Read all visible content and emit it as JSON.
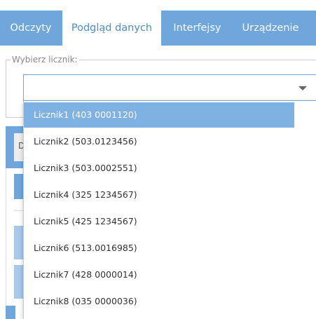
{
  "tabs": [
    {
      "label": "Odczyty",
      "active": false
    },
    {
      "label": "Podgląd danych",
      "active": true
    },
    {
      "label": "Interfejsy",
      "active": false
    },
    {
      "label": "Urządzenie",
      "active": false
    }
  ],
  "meter_select": {
    "legend": "Wybierz licznik:",
    "value": "",
    "options": [
      "Licznik1 (403 0001120)",
      "Licznik2 (503.0123456)",
      "Licznik3 (503.0002551)",
      "Licznik4 (325 1234567)",
      "Licznik5 (425 1234567)",
      "Licznik6 (513.0016985)",
      "Licznik7 (428 0000014)",
      "Licznik8 (035 0000036)"
    ],
    "highlighted_index": 0
  },
  "background": {
    "header_fragment": "D"
  },
  "colors": {
    "accent": "#6fa6dc",
    "highlight": "#7fb1e3"
  }
}
